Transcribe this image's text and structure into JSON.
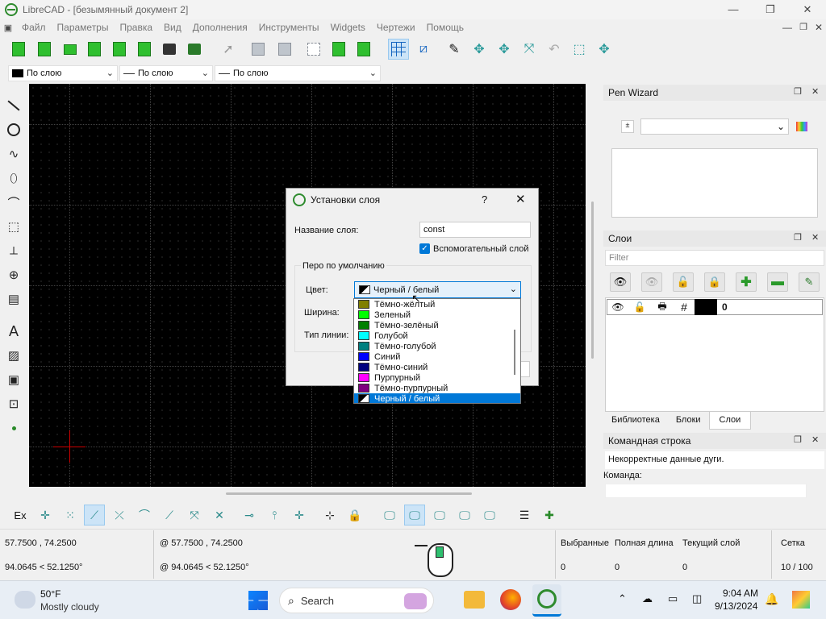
{
  "window": {
    "title": "LibreCAD - [безымянный документ 2]"
  },
  "menu": [
    "Файл",
    "Параметры",
    "Правка",
    "Вид",
    "Дополнения",
    "Инструменты",
    "Widgets",
    "Чертежи",
    "Помощь"
  ],
  "pen_combos": {
    "color": "По слою",
    "width": "По слою",
    "type": "По слою"
  },
  "pen_wizard": {
    "title": "Pen Wizard"
  },
  "layers_panel": {
    "title": "Слои",
    "filter_placeholder": "Filter",
    "layer_row": {
      "name": "0"
    },
    "tabs": [
      "Библиотека",
      "Блоки",
      "Слои"
    ]
  },
  "command_panel": {
    "title": "Командная строка",
    "message": "Некорректные данные дуги.",
    "prompt": "Команда:"
  },
  "dialog": {
    "title": "Установки слоя",
    "help": "?",
    "name_label": "Название слоя:",
    "name_value": "const",
    "helper_checkbox": "Вспомогательный слой",
    "pen_group": "Перо по умолчанию",
    "color_label": "Цвет:",
    "color_value": "Черный / белый",
    "width_label": "Ширина:",
    "linetype_label": "Тип линии:",
    "color_options": [
      {
        "label": "Тёмно-жёлтый",
        "color": "#808000"
      },
      {
        "label": "Зеленый",
        "color": "#00ff00"
      },
      {
        "label": "Тёмно-зелёный",
        "color": "#008000"
      },
      {
        "label": "Голубой",
        "color": "#00ffff"
      },
      {
        "label": "Тёмно-голубой",
        "color": "#008080"
      },
      {
        "label": "Синий",
        "color": "#0000ff"
      },
      {
        "label": "Тёмно-синий",
        "color": "#000080"
      },
      {
        "label": "Пурпурный",
        "color": "#ff00ff"
      },
      {
        "label": "Тёмно-пурпурный",
        "color": "#800080"
      },
      {
        "label": "Черный / белый",
        "color": "#000000",
        "selected": true
      }
    ]
  },
  "bottom_toolbar": {
    "ex_label": "Ex"
  },
  "status": {
    "coord_abs": "57.7500 , 74.2500",
    "coord_polar": "94.0645 < 52.1250°",
    "coord_rel_abs": "@  57.7500 , 74.2500",
    "coord_rel_polar": "@  94.0645 < 52.1250°",
    "selected_label": "Выбранные",
    "selected_value": "0",
    "length_label": "Полная длина",
    "length_value": "0",
    "layer_label": "Текущий слой",
    "layer_value": "0",
    "grid_label": "Сетка",
    "grid_value": "10 / 100"
  },
  "taskbar": {
    "weather_temp": "50°F",
    "weather_desc": "Mostly cloudy",
    "search_placeholder": "Search",
    "time": "9:04 AM",
    "date": "9/13/2024"
  }
}
